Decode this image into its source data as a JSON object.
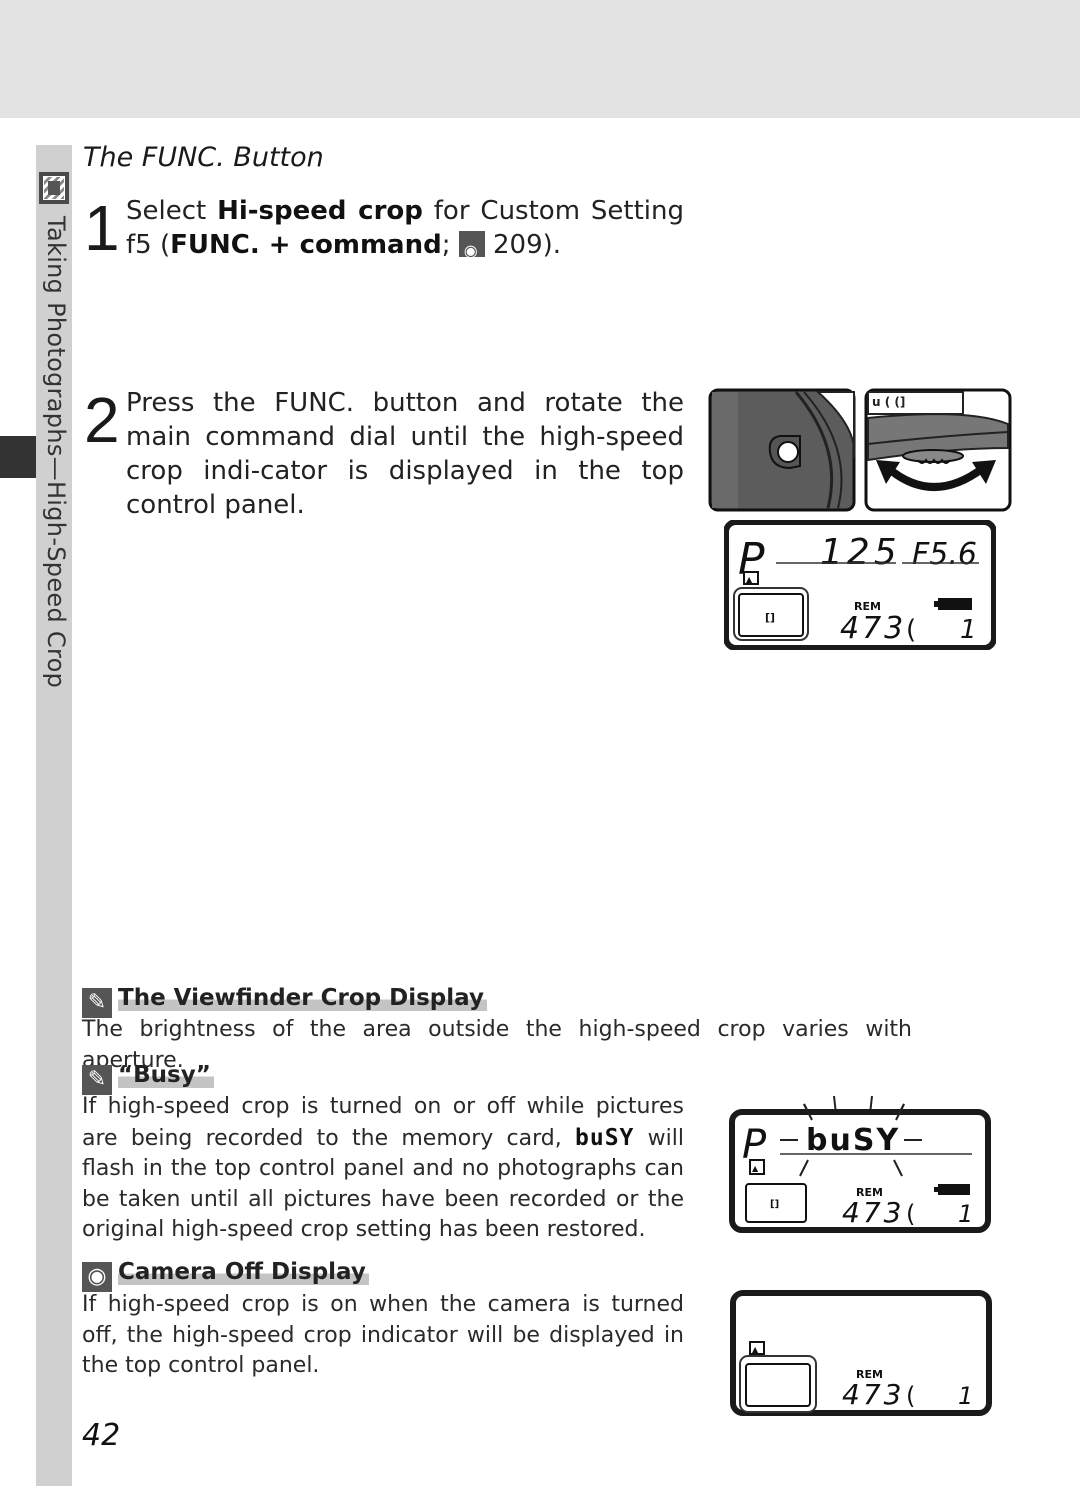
{
  "page": {
    "section_tab": "Taking Photographs—High-Speed Crop",
    "title": "The FUNC. Button",
    "page_number": "42"
  },
  "steps": [
    {
      "number": "1",
      "text_before": "Select ",
      "bold1": "Hi-speed crop",
      "text_mid": " for Custom Setting f5 (",
      "bold2": "FUNC. + command",
      "text_after": "; ",
      "ref_icon": "page-reference-icon",
      "ref_page": "209).",
      "closing": ""
    },
    {
      "number": "2",
      "text": "Press the FUNC. button and rotate the main command dial until the high-speed crop indi-cator is displayed in the top control panel."
    }
  ],
  "control_panel_1": {
    "mode": "P",
    "shutter": "125",
    "aperture": "F5.6",
    "rem_label": "REM",
    "remaining": "473",
    "buffer": "1"
  },
  "notes": [
    {
      "icon": "pencil-icon",
      "heading": "The Viewfinder Crop Display",
      "body": "The brightness of the area outside the high-speed crop varies with aperture."
    },
    {
      "icon": "pencil-icon",
      "heading": "“Busy”",
      "body_before": "If high-speed crop is turned on or off while pictures are being recorded to the memory card, ",
      "busy_glyph": "buSY",
      "body_after": " will flash in the top control panel and no photographs can be taken until all pictures have been recorded or the original high-speed crop setting has been restored."
    },
    {
      "icon": "camera-off-icon",
      "heading": "Camera Off Display",
      "body": "If high-speed crop is on when the camera is turned off, the high-speed crop indicator will be displayed in the top control panel."
    }
  ],
  "control_panel_busy": {
    "mode": "P",
    "busy": "buSY",
    "rem_label": "REM",
    "remaining": "473",
    "buffer": "1"
  },
  "control_panel_off": {
    "rem_label": "REM",
    "remaining": "473",
    "buffer": "1"
  },
  "icons": {
    "section_icon": "shooting-mode-icon",
    "dial_arrow": "rotate-arrow-icon"
  }
}
